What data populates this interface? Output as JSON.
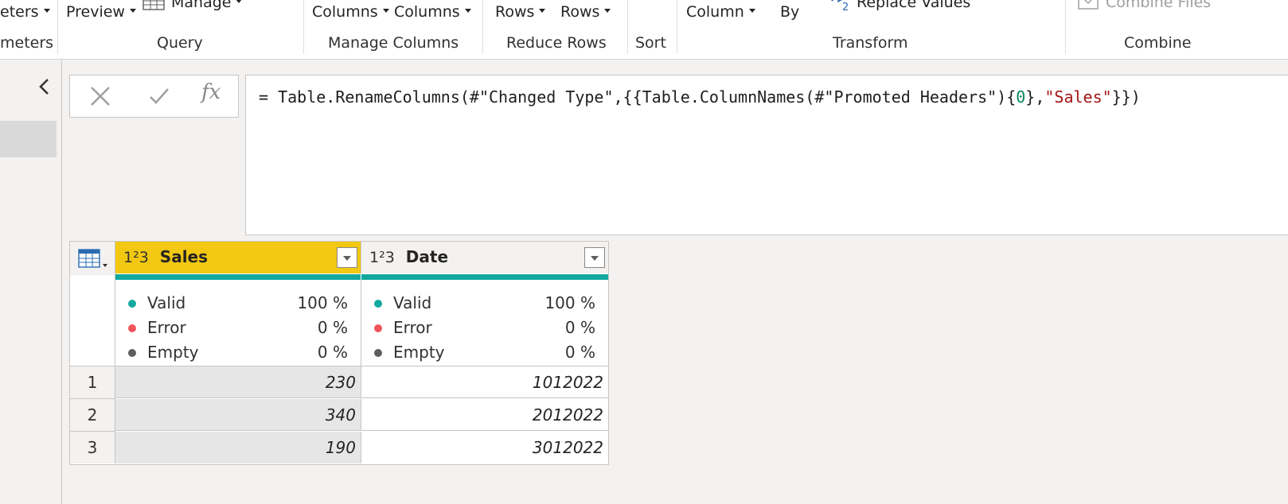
{
  "ribbon": {
    "groups": [
      {
        "label": "meters",
        "buttons": [
          {
            "label": "eters",
            "dropdown": true
          }
        ]
      },
      {
        "label": "Query",
        "buttons": [
          {
            "label": "Preview",
            "dropdown": true
          },
          {
            "label": "Manage",
            "dropdown": true
          }
        ]
      },
      {
        "label": "Manage Columns",
        "buttons": [
          {
            "label": "Columns",
            "dropdown": true
          },
          {
            "label": "Columns",
            "dropdown": true
          }
        ]
      },
      {
        "label": "Reduce Rows",
        "buttons": [
          {
            "label": "Rows",
            "dropdown": true
          },
          {
            "label": "Rows",
            "dropdown": true
          }
        ]
      },
      {
        "label": "Sort",
        "buttons": []
      },
      {
        "label": "Transform",
        "buttons": [
          {
            "label": "Column",
            "dropdown": true
          },
          {
            "label": "By",
            "dropdown": false
          },
          {
            "label": "Replace Values",
            "dropdown": false
          }
        ]
      },
      {
        "label": "Combine",
        "buttons": [
          {
            "label": "Combine Files",
            "dropdown": false
          }
        ]
      }
    ]
  },
  "formula_bar": {
    "fx_label": "fx",
    "part_prefix": "= Table.RenameColumns(#\"Changed Type\",{{Table.ColumnNames(#\"Promoted Headers\"){",
    "part_number": "0",
    "part_mid": "},",
    "part_string": "\"Sales\"",
    "part_suffix": "}})"
  },
  "table": {
    "type_icon_text": "1²3",
    "columns": [
      {
        "name": "Sales",
        "type": "1²3",
        "selected": true,
        "profile": {
          "valid": "100 %",
          "error": "0 %",
          "empty": "0 %"
        }
      },
      {
        "name": "Date",
        "type": "1²3",
        "selected": false,
        "profile": {
          "valid": "100 %",
          "error": "0 %",
          "empty": "0 %"
        }
      }
    ],
    "profile_labels": {
      "valid": "Valid",
      "error": "Error",
      "empty": "Empty"
    },
    "rows": [
      {
        "n": "1",
        "sales": "230",
        "date": "1012022"
      },
      {
        "n": "2",
        "sales": "340",
        "date": "2012022"
      },
      {
        "n": "3",
        "sales": "190",
        "date": "3012022"
      }
    ]
  },
  "colors": {
    "selected_header": "#f2c811",
    "quality_bar": "#13a89e",
    "valid": "#13a89e",
    "error": "#f1545c",
    "empty": "#605e5c"
  }
}
